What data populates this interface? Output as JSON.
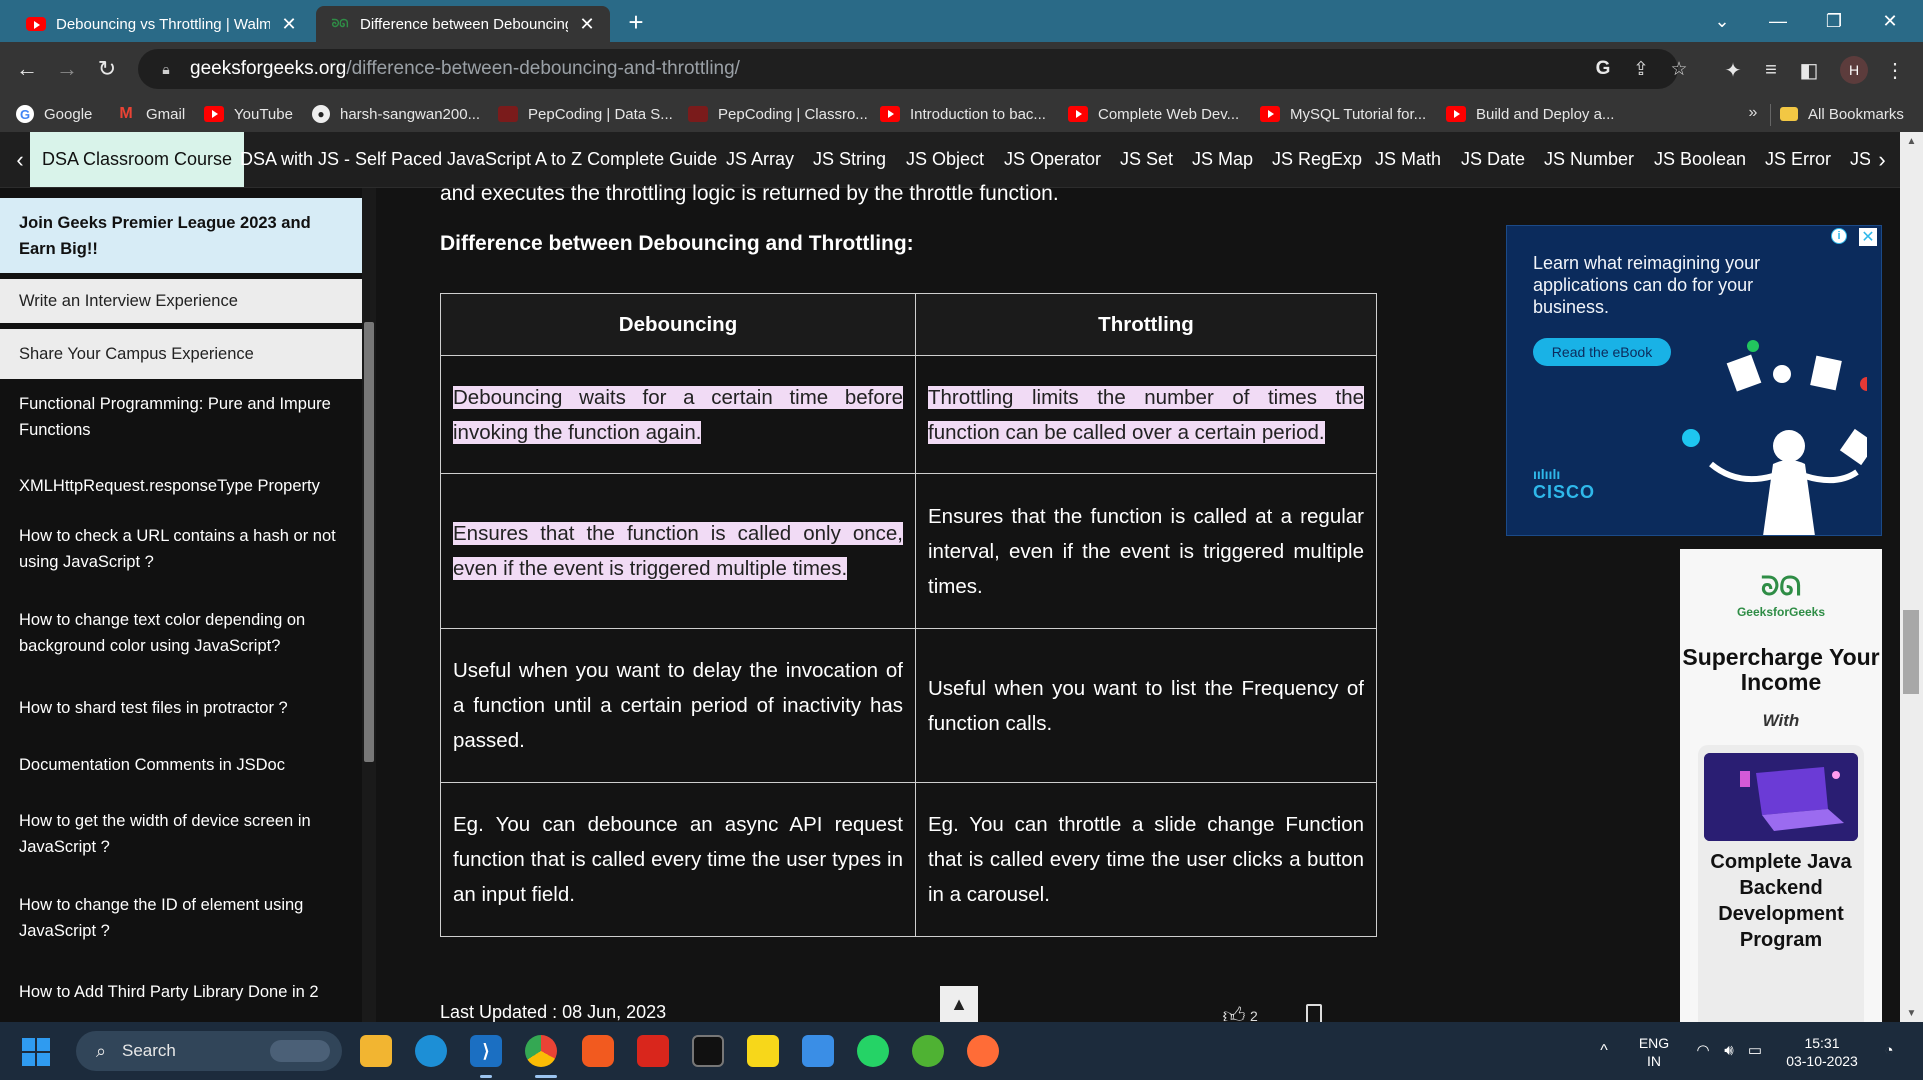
{
  "browser": {
    "tabs": [
      {
        "title": "Debouncing vs Throttling | Walm",
        "close": "✕"
      },
      {
        "title": "Difference between Debouncing",
        "close": "✕"
      }
    ],
    "new_tab": "+",
    "window": {
      "dropdown": "⌄",
      "minimize": "—",
      "restore": "❐",
      "close": "✕"
    },
    "address": {
      "host": "geeksforgeeks.org",
      "path": "/difference-between-debouncing-and-throttling/"
    },
    "profile_initial": "H",
    "bookmarks": [
      {
        "label": "Google",
        "icon": "google-icon"
      },
      {
        "label": "Gmail",
        "icon": "gmail-icon"
      },
      {
        "label": "YouTube",
        "icon": "youtube-icon"
      },
      {
        "label": "harsh-sangwan200...",
        "icon": "github-icon"
      },
      {
        "label": "PepCoding | Data S...",
        "icon": "pepcoding-icon"
      },
      {
        "label": "PepCoding | Classro...",
        "icon": "pepcoding-icon"
      },
      {
        "label": "Introduction to bac...",
        "icon": "youtube-icon"
      },
      {
        "label": "Complete Web Dev...",
        "icon": "youtube-icon"
      },
      {
        "label": "MySQL Tutorial for...",
        "icon": "youtube-icon"
      },
      {
        "label": "Build and Deploy a...",
        "icon": "youtube-icon"
      }
    ],
    "bookmarks_more": "»",
    "all_bookmarks": "All Bookmarks"
  },
  "topnav": {
    "items": [
      "DSA Classroom Course",
      "DSA with JS - Self Paced",
      "JavaScript A to Z Complete Guide",
      "JS Array",
      "JS String",
      "JS Object",
      "JS Operator",
      "JS Set",
      "JS Map",
      "JS RegExp",
      "JS Math",
      "JS Date",
      "JS Number",
      "JS Boolean",
      "JS Error",
      "JS"
    ],
    "left_arrow": "‹",
    "right_arrow": "›"
  },
  "sidebar": {
    "items": [
      "Join Geeks Premier League 2023 and Earn Big!!",
      "Write an Interview Experience",
      "Share Your Campus Experience",
      "Functional Programming: Pure and Impure Functions",
      "XMLHttpRequest.responseType Property",
      "How to check a URL contains a hash or not using JavaScript ?",
      "How to change text color depending on background color using JavaScript?",
      "How to shard test files in protractor ?",
      "Documentation Comments in JSDoc",
      "How to get the width of device screen in JavaScript ?",
      "How to change the ID of element using JavaScript ?",
      "How to Add Third Party Library Done in 2"
    ]
  },
  "article": {
    "lead": "and executes the throttling logic is returned by the throttle function.",
    "heading": "Difference between Debouncing and Throttling:",
    "table": {
      "headers": [
        "Debouncing",
        "Throttling"
      ],
      "rows": [
        [
          "Debouncing waits for a certain time before invoking the function again.",
          "Throttling limits the number of times the function can be called over a certain period."
        ],
        [
          "Ensures that the function is called only once, even if the event is triggered multiple times.",
          "Ensures that the function is called at a regular interval, even if the event is triggered multiple times."
        ],
        [
          "Useful when you want to delay the invocation of a function until a certain period of inactivity has passed.",
          "Useful when you want to list the Frequency of function calls."
        ],
        [
          "Eg. You can debounce an async API request function that is called every time the user types in an input field.",
          "Eg. You can throttle a slide change Function that is called every time the user clicks a button in a carousel."
        ]
      ]
    },
    "last_updated": "Last Updated : 08 Jun, 2023",
    "like_count": "2"
  },
  "ads": {
    "cisco": {
      "text": "Learn what reimagining your applications can do for your business.",
      "cta": "Read the eBook",
      "brand": "CISCO",
      "info": "i",
      "close": "✕"
    },
    "gfg": {
      "logo": "GeeksforGeeks",
      "headline": "Supercharge Your Income",
      "with": "With",
      "course": "Complete Java Backend Development Program"
    }
  },
  "taskbar": {
    "search": "Search",
    "lang_top": "ENG",
    "lang_bottom": "IN",
    "time": "15:31",
    "date": "03-10-2023"
  },
  "colors": {
    "gfg_green": "#2f8d46",
    "highlight": "#f1dbf5",
    "tab_bar": "#2a6a87"
  }
}
